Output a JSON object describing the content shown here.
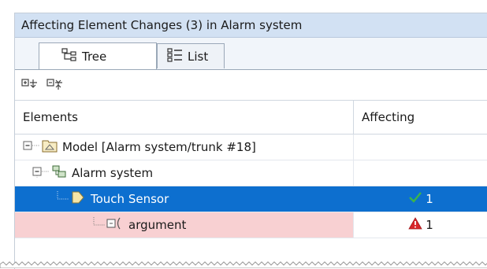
{
  "panel": {
    "title": "Affecting Element Changes (3) in Alarm system"
  },
  "tabs": [
    {
      "label": "Tree",
      "icon": "tree-icon",
      "active": true
    },
    {
      "label": "List",
      "icon": "list-icon",
      "active": false
    }
  ],
  "toolbar": {
    "expand_icon": "expand-all-icon",
    "collapse_icon": "collapse-all-icon"
  },
  "table": {
    "columns": [
      "Elements",
      "Affecting"
    ],
    "rows": [
      {
        "label": "Model [Alarm system/trunk #18]",
        "icon": "model-package-icon",
        "affecting": "",
        "status": ""
      },
      {
        "label": "Alarm system",
        "icon": "block-icon",
        "affecting": "",
        "status": ""
      },
      {
        "label": "Touch Sensor",
        "icon": "port-icon",
        "affecting": "1",
        "status": "check-icon"
      },
      {
        "label": "argument",
        "icon": "parameter-icon",
        "affecting": "1",
        "status": "warning-icon"
      }
    ]
  },
  "colors": {
    "title_bg": "#d2e1f3",
    "selection": "#0d6fcf",
    "warning_row": "#f8d0d2",
    "check": "#3cb54a",
    "warning": "#d9262b"
  }
}
